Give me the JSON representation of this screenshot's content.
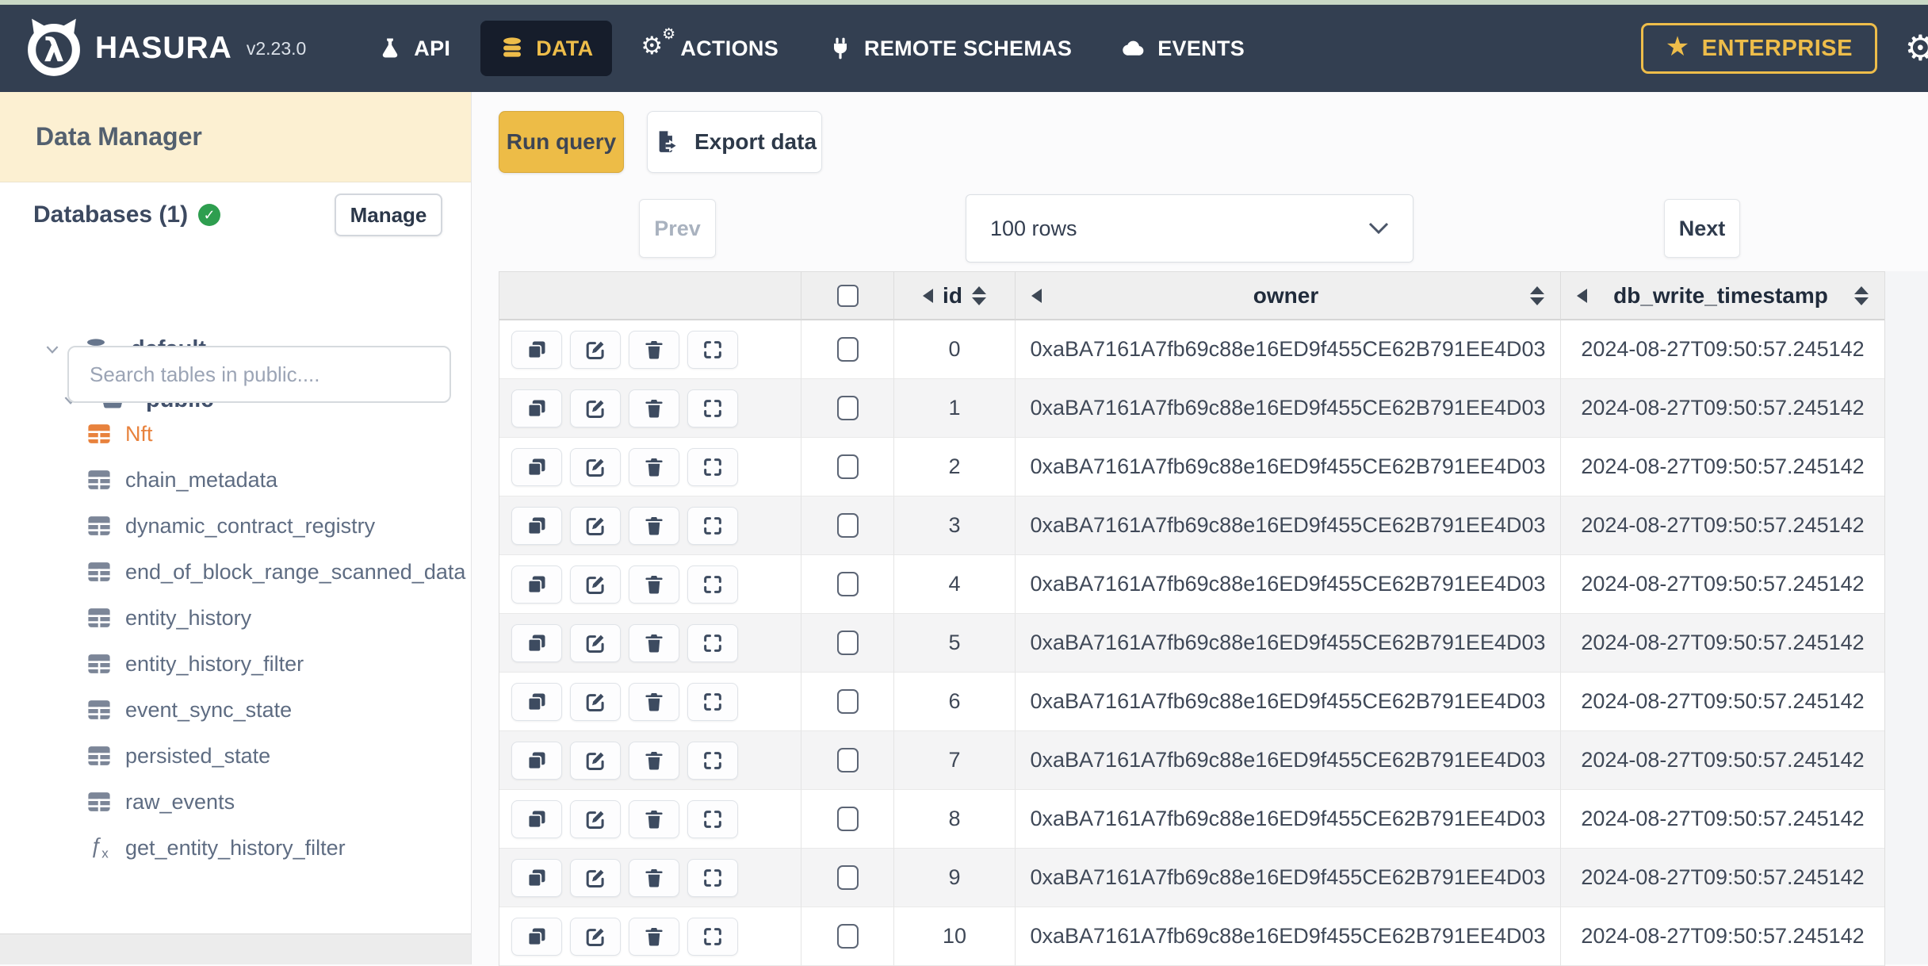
{
  "topbar": {
    "brand": "HASURA",
    "version": "v2.23.0",
    "nav": [
      {
        "label": "API",
        "icon": "flask-icon",
        "active": false
      },
      {
        "label": "DATA",
        "icon": "database-icon",
        "active": true
      },
      {
        "label": "ACTIONS",
        "icon": "gears-icon",
        "active": false
      },
      {
        "label": "REMOTE SCHEMAS",
        "icon": "plug-icon",
        "active": false
      },
      {
        "label": "EVENTS",
        "icon": "cloud-icon",
        "active": false
      }
    ],
    "enterprise": {
      "label": "ENTERPRISE",
      "icon": "star-icon"
    },
    "colors": {
      "nav_bg": "#333f51",
      "active_tab_bg": "#161d2b",
      "accent_gold": "#eebd4a"
    }
  },
  "sidebar": {
    "title": "Data Manager",
    "databases_label": "Databases (1)",
    "manage_label": "Manage",
    "tree": [
      {
        "label": "default",
        "icon": "database-icon"
      },
      {
        "label": "public",
        "icon": "folder-icon"
      }
    ],
    "search_placeholder": "Search tables in public....",
    "tables": [
      {
        "name": "Nft",
        "icon": "table-icon",
        "active": true
      },
      {
        "name": "chain_metadata",
        "icon": "table-icon",
        "active": false
      },
      {
        "name": "dynamic_contract_registry",
        "icon": "table-icon",
        "active": false
      },
      {
        "name": "end_of_block_range_scanned_data",
        "icon": "table-icon",
        "active": false
      },
      {
        "name": "entity_history",
        "icon": "table-icon",
        "active": false
      },
      {
        "name": "entity_history_filter",
        "icon": "table-icon",
        "active": false
      },
      {
        "name": "event_sync_state",
        "icon": "table-icon",
        "active": false
      },
      {
        "name": "persisted_state",
        "icon": "table-icon",
        "active": false
      },
      {
        "name": "raw_events",
        "icon": "table-icon",
        "active": false
      },
      {
        "name": "get_entity_history_filter",
        "icon": "function-icon",
        "active": false
      }
    ],
    "active_color": "#e8823d"
  },
  "toolbar": {
    "run_query_label": "Run query",
    "export_label": "Export data",
    "run_query_bg": "#edbc47"
  },
  "pagination": {
    "prev_label": "Prev",
    "next_label": "Next",
    "page_size_value": "100 rows"
  },
  "table": {
    "columns": [
      {
        "key": "id",
        "label": "id"
      },
      {
        "key": "owner",
        "label": "owner"
      },
      {
        "key": "db_write_timestamp",
        "label": "db_write_timestamp"
      }
    ],
    "rows": [
      {
        "id": "0",
        "owner": "0xaBA7161A7fb69c88e16ED9f455CE62B791EE4D03",
        "db_write_timestamp": "2024-08-27T09:50:57.245142"
      },
      {
        "id": "1",
        "owner": "0xaBA7161A7fb69c88e16ED9f455CE62B791EE4D03",
        "db_write_timestamp": "2024-08-27T09:50:57.245142"
      },
      {
        "id": "2",
        "owner": "0xaBA7161A7fb69c88e16ED9f455CE62B791EE4D03",
        "db_write_timestamp": "2024-08-27T09:50:57.245142"
      },
      {
        "id": "3",
        "owner": "0xaBA7161A7fb69c88e16ED9f455CE62B791EE4D03",
        "db_write_timestamp": "2024-08-27T09:50:57.245142"
      },
      {
        "id": "4",
        "owner": "0xaBA7161A7fb69c88e16ED9f455CE62B791EE4D03",
        "db_write_timestamp": "2024-08-27T09:50:57.245142"
      },
      {
        "id": "5",
        "owner": "0xaBA7161A7fb69c88e16ED9f455CE62B791EE4D03",
        "db_write_timestamp": "2024-08-27T09:50:57.245142"
      },
      {
        "id": "6",
        "owner": "0xaBA7161A7fb69c88e16ED9f455CE62B791EE4D03",
        "db_write_timestamp": "2024-08-27T09:50:57.245142"
      },
      {
        "id": "7",
        "owner": "0xaBA7161A7fb69c88e16ED9f455CE62B791EE4D03",
        "db_write_timestamp": "2024-08-27T09:50:57.245142"
      },
      {
        "id": "8",
        "owner": "0xaBA7161A7fb69c88e16ED9f455CE62B791EE4D03",
        "db_write_timestamp": "2024-08-27T09:50:57.245142"
      },
      {
        "id": "9",
        "owner": "0xaBA7161A7fb69c88e16ED9f455CE62B791EE4D03",
        "db_write_timestamp": "2024-08-27T09:50:57.245142"
      },
      {
        "id": "10",
        "owner": "0xaBA7161A7fb69c88e16ED9f455CE62B791EE4D03",
        "db_write_timestamp": "2024-08-27T09:50:57.245142"
      }
    ]
  },
  "icons": {
    "star": "★",
    "gear": "⚙",
    "check": "✓",
    "fx": "ƒ"
  }
}
